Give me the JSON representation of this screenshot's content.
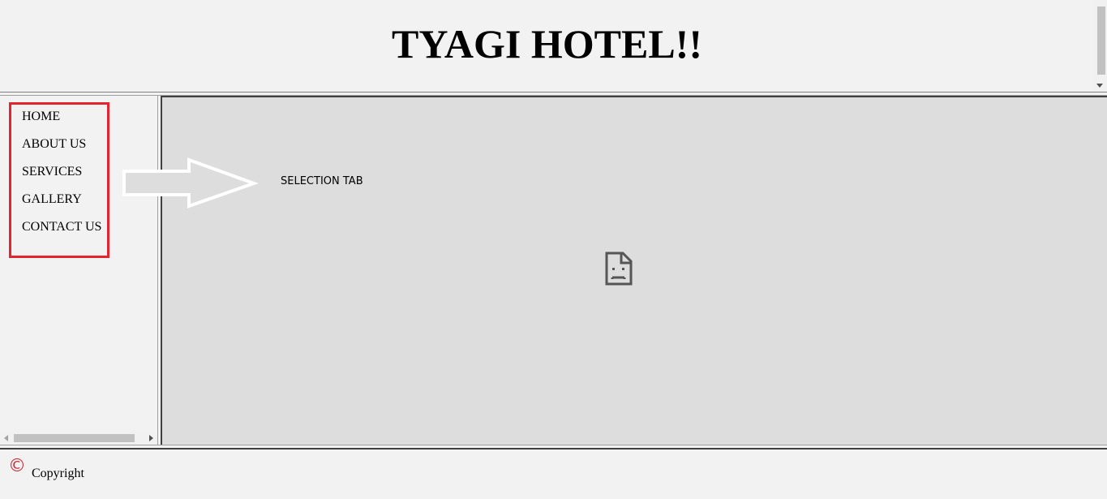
{
  "header": {
    "title": "TYAGI HOTEL!!"
  },
  "sidebar": {
    "items": [
      {
        "label": "HOME"
      },
      {
        "label": "ABOUT US"
      },
      {
        "label": "SERVICES"
      },
      {
        "label": "GALLERY"
      },
      {
        "label": "CONTACT US"
      }
    ],
    "highlight_color": "#e3232e"
  },
  "main": {
    "annotation_label": "SELECTION TAB",
    "content_icon": "broken-page-icon",
    "background_color": "#dddddd"
  },
  "footer": {
    "copyright_symbol": "©",
    "copyright_label": "Copyright",
    "symbol_color": "#c8303a"
  }
}
